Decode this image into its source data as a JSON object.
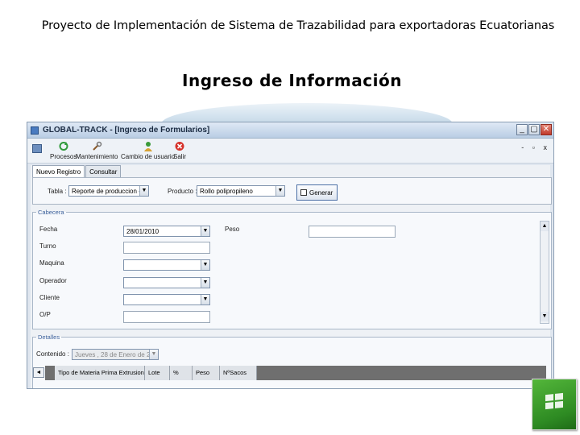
{
  "slide": {
    "header": "Proyecto de Implementación de Sistema de Trazabilidad para exportadoras Ecuatorianas",
    "title": "Ingreso de Información"
  },
  "window": {
    "title": "GLOBAL-TRACK - [Ingreso de Formularios]",
    "controls": {
      "minimize": "_",
      "maximize": "▢",
      "close": "✕"
    },
    "mdi_controls": "- ▫ x"
  },
  "toolbar": {
    "items": [
      {
        "label": "Procesos",
        "icon": "refresh-icon"
      },
      {
        "label": "Mantenimiento",
        "icon": "wrench-icon"
      },
      {
        "label": "Cambio de usuario",
        "icon": "user-icon"
      },
      {
        "label": "Salir",
        "icon": "exit-icon"
      }
    ]
  },
  "tabs": [
    {
      "label": "Nuevo Registro",
      "active": true
    },
    {
      "label": "Consultar",
      "active": false
    }
  ],
  "filter": {
    "tabla_label": "Tabla :",
    "tabla_value": "Reporte de produccion - Extrusi",
    "producto_label": "Producto :",
    "producto_value": "Rollo polipropileno",
    "generar_label": "Generar"
  },
  "cabecera": {
    "legend": "Cabecera",
    "fields": {
      "fecha_label": "Fecha",
      "fecha_value": "28/01/2010",
      "turno_label": "Turno",
      "maquina_label": "Maquina",
      "operador_label": "Operador",
      "cliente_label": "Cliente",
      "op_label": "O/P",
      "peso_label": "Peso"
    }
  },
  "detalles": {
    "legend": "Detalles",
    "contenido_label": "Contenido :",
    "contenido_value": "Jueves , 28 de   Enero  de 2",
    "columns": [
      "Tipo de Materia Prima Extrusion",
      "Lote",
      "%",
      "Peso",
      "NºSacos"
    ]
  },
  "colors": {
    "titlebar": "#b9cde4",
    "window_bg": "#dfe6ef",
    "legend_text": "#3a5f9a",
    "logo_green": "#2e8b23"
  }
}
